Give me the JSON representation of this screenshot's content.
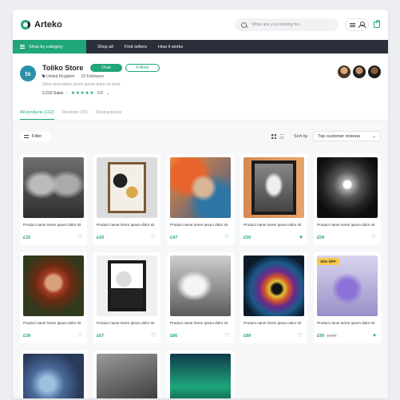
{
  "app": {
    "name": "Arteko",
    "search_placeholder": "What are you looking for..."
  },
  "nav": {
    "category_button": "Shop by category",
    "links": [
      "Shop all",
      "Find sellers",
      "How it works"
    ]
  },
  "store": {
    "avatar_text": "ts",
    "name": "Toliko Store",
    "chat_label": "Chat",
    "follow_label": "Follow",
    "location": "United Kingdom",
    "followers": "13 Followers",
    "description": "Store description lorem ipsum dolor sit amet",
    "sales": "2,220 Sales",
    "stars": "★★★★★",
    "rating": "5.0",
    "tabs": [
      "All products (112)",
      "Reviews (20)",
      "Shop policies"
    ]
  },
  "toolbar": {
    "filter_label": "Filter",
    "sort_label": "Sort by",
    "sort_value": "Top customer reviews",
    "sort_arrow": "⌄"
  },
  "products": [
    {
      "name": "Product name lorem ipsum dolor sit",
      "price": "£32",
      "heart": "♡"
    },
    {
      "name": "Product name lorem ipsum dolor sit",
      "price": "£43",
      "heart": "♡"
    },
    {
      "name": "Product name lorem ipsum dolor sit",
      "price": "£47",
      "heart": "♡"
    },
    {
      "name": "Product name lorem ipsum dolor sit",
      "price": "£55",
      "heart": "♥"
    },
    {
      "name": "Product name lorem ipsum dolor sit",
      "price": "£59",
      "heart": "♡"
    },
    {
      "name": "Product name lorem ipsum dolor sit",
      "price": "£39",
      "heart": "♡"
    },
    {
      "name": "Product name lorem ipsum dolor sit",
      "price": "£67",
      "heart": "♡"
    },
    {
      "name": "Product name lorem ipsum dolor sit",
      "price": "£86",
      "heart": "♡"
    },
    {
      "name": "Product name lorem ipsum dolor sit",
      "price": "£89",
      "heart": "♡"
    },
    {
      "name": "Product name lorem ipsum dolor sit",
      "price": "£90",
      "old_price": "£100",
      "badge": "10% OFF",
      "heart": "♥"
    }
  ],
  "colors": {
    "accent": "#1fa67a",
    "nav": "#2b2f3a",
    "badge": "#f2c94c"
  },
  "icons": [
    "search-icon",
    "menu-icon",
    "user-icon",
    "bag-icon",
    "location-pin-icon",
    "chevron-down-icon",
    "filter-icon",
    "grid-view-icon",
    "list-view-icon",
    "heart-icon"
  ]
}
